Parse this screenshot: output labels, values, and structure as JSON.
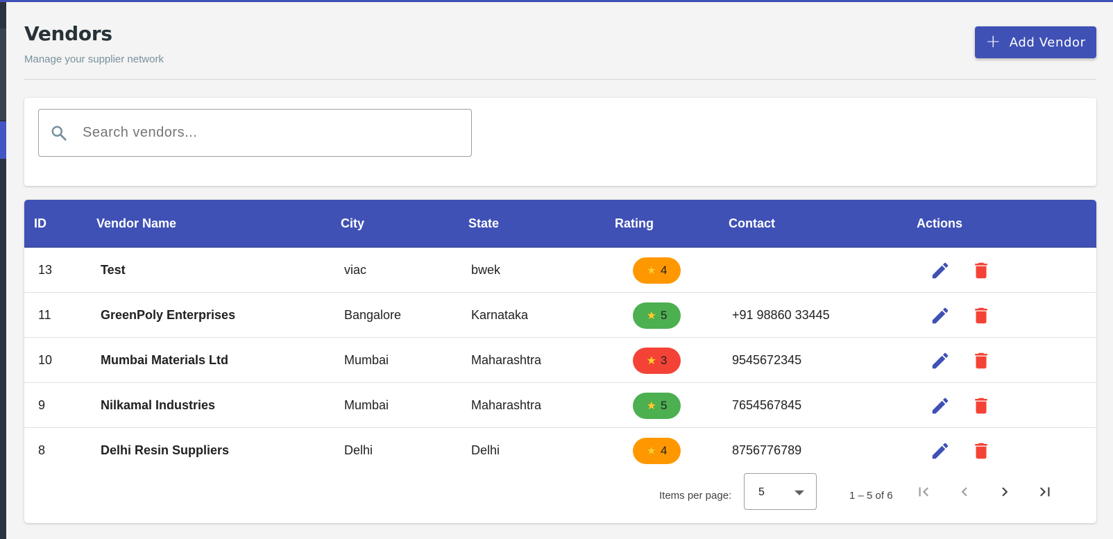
{
  "page": {
    "title": "Vendors",
    "subtitle": "Manage your supplier network"
  },
  "toolbar": {
    "add_label": "Add Vendor"
  },
  "search": {
    "placeholder": "Search vendors..."
  },
  "table": {
    "columns": [
      "ID",
      "Vendor Name",
      "City",
      "State",
      "Rating",
      "Contact",
      "Actions"
    ],
    "rows": [
      {
        "id": "13",
        "name": "Test",
        "city": "viac",
        "state": "bwek",
        "rating": "4",
        "contact": ""
      },
      {
        "id": "11",
        "name": "GreenPoly Enterprises",
        "city": "Bangalore",
        "state": "Karnataka",
        "rating": "5",
        "contact": "+91 98860 33445"
      },
      {
        "id": "10",
        "name": "Mumbai Materials Ltd",
        "city": "Mumbai",
        "state": "Maharashtra",
        "rating": "3",
        "contact": "9545672345"
      },
      {
        "id": "9",
        "name": "Nilkamal Industries",
        "city": "Mumbai",
        "state": "Maharashtra",
        "rating": "5",
        "contact": "7654567845"
      },
      {
        "id": "8",
        "name": "Delhi Resin Suppliers",
        "city": "Delhi",
        "state": "Delhi",
        "rating": "4",
        "contact": "8756776789"
      }
    ]
  },
  "rating_colors": {
    "3": "#f44336",
    "4": "#ff9800",
    "5": "#4caf50"
  },
  "pagination": {
    "items_per_page_label": "Items per page:",
    "page_size": "5",
    "range": "1 – 5 of 6"
  },
  "icons": {
    "search": "search-icon",
    "add": "plus-icon",
    "edit": "pencil-icon",
    "delete": "trash-icon",
    "first": "first-page-icon",
    "prev": "chevron-left-icon",
    "next": "chevron-right-icon",
    "last": "last-page-icon"
  },
  "colors": {
    "primary": "#3f51b5",
    "edit": "#3f51b5",
    "delete": "#f44336"
  }
}
